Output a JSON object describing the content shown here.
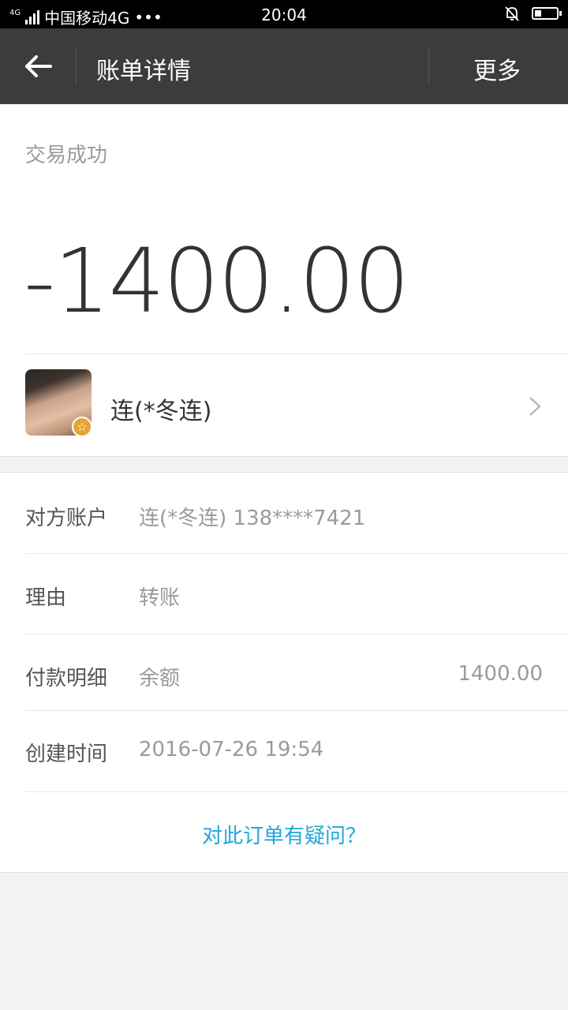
{
  "status_bar": {
    "network_tag": "4G",
    "carrier": "中国移动4G",
    "dots": "•••",
    "time": "20:04"
  },
  "header": {
    "title": "账单详情",
    "more_label": "更多"
  },
  "transaction": {
    "status": "交易成功",
    "amount": "-1400.00",
    "payee_name": "连(*冬连)"
  },
  "details": {
    "account_label": "对方账户",
    "account_value": "连(*冬连) 138****7421",
    "reason_label": "理由",
    "reason_value": "转账",
    "payment_label": "付款明细",
    "payment_method": "余额",
    "payment_amount": "1400.00",
    "created_label": "创建时间",
    "created_value": "2016-07-26 19:54",
    "question_link": "对此订单有疑问？"
  },
  "colors": {
    "header_bg": "#3c3c3c",
    "link": "#22a5d8",
    "badge": "#e6a33a"
  }
}
